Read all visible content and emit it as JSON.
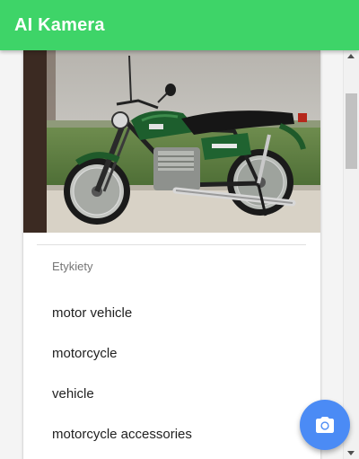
{
  "app": {
    "title": "AI Kamera"
  },
  "card": {
    "labels_heading": "Etykiety",
    "labels": [
      "motor vehicle",
      "motorcycle",
      "vehicle",
      "motorcycle accessories"
    ]
  },
  "colors": {
    "appbar": "#3ed468",
    "fab": "#4b8bf5"
  },
  "fab": {
    "icon": "camera-icon"
  }
}
